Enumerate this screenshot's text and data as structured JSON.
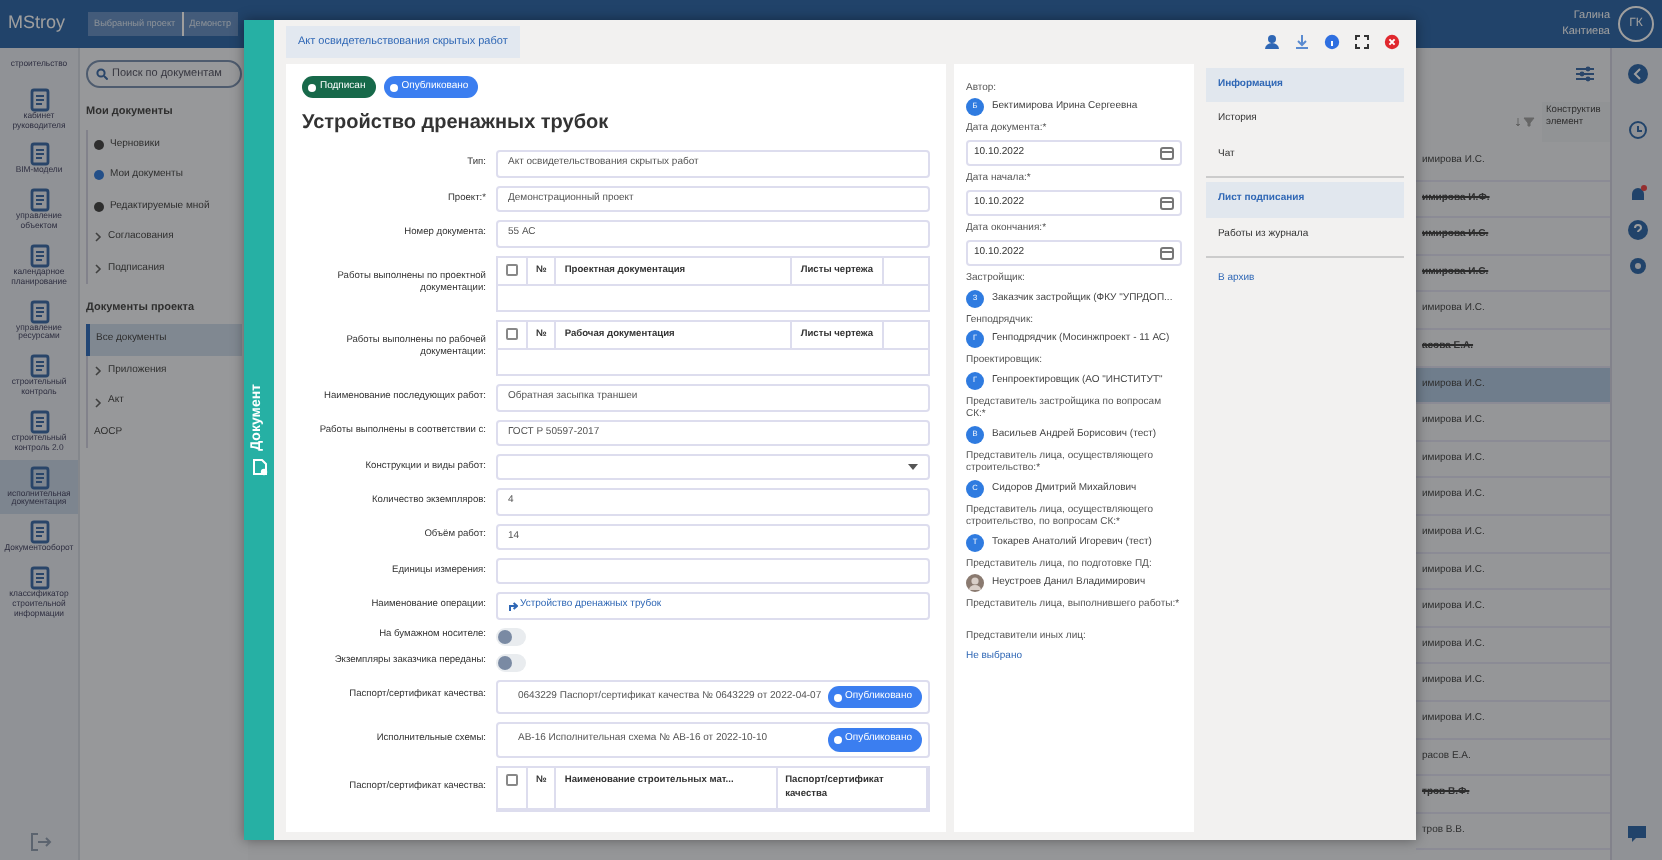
{
  "topbar": {
    "logo": "MStroy",
    "project_label": "Выбранный проект",
    "project_name": "Демонстр",
    "user_name": "Галина Кантиева",
    "user_initials": "ГК"
  },
  "nav": {
    "header": "строительство",
    "items": [
      {
        "label": "кабинет руководителя",
        "selected": false
      },
      {
        "label": "BIM-модели",
        "selected": false
      },
      {
        "label": "управление объектом",
        "selected": false
      },
      {
        "label": "календарное планирование",
        "selected": false
      },
      {
        "label": "управление ресурсами",
        "selected": false
      },
      {
        "label": "строительный контроль",
        "selected": false
      },
      {
        "label": "строительный контроль 2.0",
        "selected": false
      },
      {
        "label": "исполнительная документация",
        "selected": true
      },
      {
        "label": "Документооборот",
        "selected": false
      },
      {
        "label": "классификатор строительной информации",
        "selected": false
      },
      {
        "kind": "logout",
        "selected": false
      }
    ]
  },
  "doc_panel": {
    "search_placeholder": "Поиск по документам",
    "sections": [
      {
        "title": "Мои документы",
        "items": [
          {
            "label": "Черновики",
            "kind": "status",
            "color": "#2e2e2e",
            "selected": false
          },
          {
            "label": "Мои документы",
            "kind": "status",
            "color": "#234f89",
            "selected": false
          },
          {
            "label": "Редактируемые мной",
            "kind": "status",
            "color": "#2e2e2e",
            "selected": false
          },
          {
            "label": "Согласования",
            "kind": "folder",
            "selected": false
          },
          {
            "label": "Подписания",
            "kind": "folder",
            "selected": false
          }
        ]
      },
      {
        "title": "Документы проекта",
        "items": [
          {
            "label": "Все документы",
            "kind": "plain",
            "selected": true
          },
          {
            "label": "Приложения",
            "kind": "folder",
            "selected": false
          },
          {
            "label": "Акт",
            "kind": "folder",
            "selected": false
          },
          {
            "label": "АОСР",
            "kind": "plain",
            "selected": false
          }
        ]
      }
    ]
  },
  "background_table": {
    "column": "Конструктив элемент",
    "rows": [
      {
        "text": "имирова И.С.",
        "struck": false,
        "selected": false
      },
      {
        "text": "имирова И.Ф.",
        "struck": true,
        "selected": false
      },
      {
        "text": "имирова И.С.",
        "struck": true,
        "selected": false
      },
      {
        "text": "имирова И.С.",
        "struck": true,
        "selected": false
      },
      {
        "text": "имирова И.С.",
        "struck": false,
        "selected": false
      },
      {
        "text": "асова Е.А.",
        "struck": true,
        "selected": false
      },
      {
        "text": "имирова И.С.",
        "struck": false,
        "selected": true
      },
      {
        "text": "имирова И.С.",
        "struck": false,
        "selected": false
      },
      {
        "text": "имирова И.С.",
        "struck": false,
        "selected": false
      },
      {
        "text": "имирова И.С.",
        "struck": false,
        "selected": false
      },
      {
        "text": "имирова И.С.",
        "struck": false,
        "selected": false
      },
      {
        "text": "имирова И.С.",
        "struck": false,
        "selected": false
      },
      {
        "text": "имирова И.С.",
        "struck": false,
        "selected": false
      },
      {
        "text": "имирова И.С.",
        "struck": false,
        "selected": false
      },
      {
        "text": "имирова И.С.",
        "struck": false,
        "selected": false
      },
      {
        "text": "имирова И.С.",
        "struck": false,
        "selected": false
      },
      {
        "text": "расов Е.А.",
        "struck": false,
        "selected": false
      },
      {
        "text": "тров В.Ф.",
        "struck": true,
        "selected": false
      },
      {
        "text": "тров В.В.",
        "struck": false,
        "selected": false
      }
    ]
  },
  "modal": {
    "side_label": "Документ",
    "tab": "Акт освидетельствования скрытых работ",
    "badges": [
      {
        "label": "Подписан",
        "color": "#17694a"
      },
      {
        "label": "Опубликовано",
        "color": "#3b7ef0"
      }
    ],
    "title": "Устройство дренажных трубок",
    "fields": [
      {
        "kind": "text",
        "label": "Тип:",
        "value": "Акт освидетельствования скрытых работ"
      },
      {
        "kind": "text",
        "label": "Проект:*",
        "value": "Демонстрационный проект"
      },
      {
        "kind": "text",
        "label": "Номер документа:",
        "value": "55 АС"
      },
      {
        "kind": "table",
        "label": "Работы выполнены по проектной документации:",
        "checked": false,
        "columns": [
          "№",
          "Проектная документация",
          "Листы чертежа"
        ]
      },
      {
        "kind": "table",
        "label": "Работы выполнены по рабочей документации:",
        "checked": false,
        "columns": [
          "№",
          "Рабочая документация",
          "Листы чертежа"
        ]
      },
      {
        "kind": "text",
        "label": "Наименование последующих работ:",
        "value": "Обратная засыпка траншеи"
      },
      {
        "kind": "text",
        "label": "Работы выполнены в соответствии с:",
        "value": "ГОСТ Р 50597-2017"
      },
      {
        "kind": "select",
        "label": "Конструкции и виды работ:"
      },
      {
        "kind": "text",
        "label": "Количество экземпляров:",
        "value": "4"
      },
      {
        "kind": "text",
        "label": "Объём работ:",
        "value": "14"
      },
      {
        "kind": "text",
        "label": "Единицы измерения:"
      },
      {
        "kind": "link",
        "label": "Наименование операции:",
        "value": "Устройство дренажных трубок"
      },
      {
        "kind": "toggle",
        "label": "На бумажном носителе:",
        "on": false
      },
      {
        "kind": "toggle",
        "label": "Экземпляры заказчика переданы:",
        "on": false
      },
      {
        "kind": "attachment",
        "label": "Паспорт/сертификат качества:",
        "value": "0643229 Паспорт/сертификат качества № 0643229 от 2022-04-07",
        "badge": "Опубликовано"
      },
      {
        "kind": "attachment",
        "label": "Исполнительные схемы:",
        "value": "АВ-16 Исполнительная схема № АВ-16 от 2022-10-10",
        "badge": "Опубликовано"
      },
      {
        "kind": "table",
        "label": "Паспорт/сертификат качества:",
        "checked": false,
        "columns": [
          "№",
          "Наименование строительных мат...",
          "Паспорт/сертификат качества"
        ]
      }
    ],
    "participants": [
      {
        "kind": "person",
        "label": "Автор:",
        "initial": "Б",
        "name": "Бектимирова Ирина Сергеевна"
      },
      {
        "kind": "date",
        "label": "Дата документа:*",
        "value": "10.10.2022"
      },
      {
        "kind": "date",
        "label": "Дата начала:*",
        "value": "10.10.2022"
      },
      {
        "kind": "date",
        "label": "Дата окончания:*",
        "value": "10.10.2022"
      },
      {
        "kind": "person",
        "label": "Застройщик:",
        "initial": "З",
        "name": "Заказчик застройщик (ФКУ \"УПРДОП..."
      },
      {
        "kind": "person",
        "label": "Генподрядчик:",
        "initial": "Г",
        "name": "Генподрядчик (Мосинжпроект - 11 АС)"
      },
      {
        "kind": "person",
        "label": "Проектировщик:",
        "initial": "Г",
        "name": "Генпроектировщик (АО \"ИНСТИТУТ\""
      },
      {
        "kind": "person",
        "label": "Представитель застройщика по вопросам СК:*",
        "initial": "В",
        "name": "Васильев Андрей Борисович (тест)"
      },
      {
        "kind": "person",
        "label": "Представитель лица, осуществляющего строительство:*",
        "initial": "С",
        "name": "Сидоров Дмитрий Михайлович"
      },
      {
        "kind": "person",
        "label": "Представитель лица, осуществляющего строительство, по вопросам СК:*",
        "initial": "Т",
        "name": "Токарев Анатолий Игоревич (тест)"
      },
      {
        "kind": "photo",
        "label": "Представитель лица, по подготовке ПД:",
        "name": "Неустроев Данил Владимирович"
      },
      {
        "kind": "empty",
        "label": "Представитель лица, выполнившего работы:*"
      },
      {
        "kind": "link",
        "label": "Представители иных лиц:",
        "value": "Не выбрано"
      }
    ],
    "menu": [
      [
        {
          "label": "Информация",
          "selected": true
        },
        {
          "label": "История",
          "selected": false
        },
        {
          "label": "Чат",
          "selected": false
        }
      ],
      [
        {
          "label": "Лист подписания",
          "selected": true
        },
        {
          "label": "Работы из журнала",
          "selected": false
        }
      ],
      [
        {
          "label": "В архив",
          "selected": false,
          "kind": "link"
        }
      ]
    ]
  }
}
